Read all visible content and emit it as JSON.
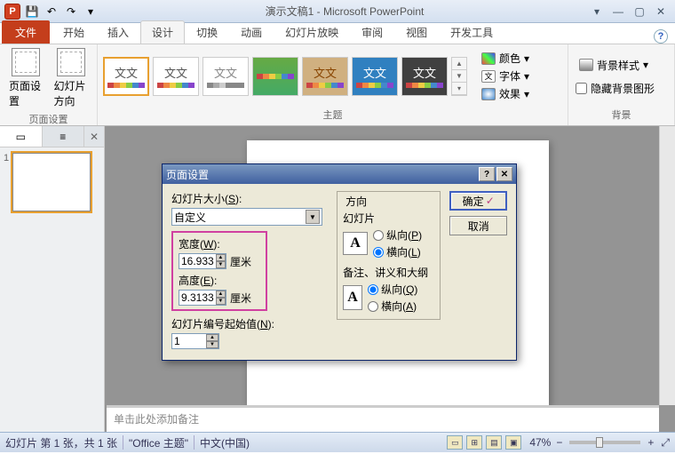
{
  "titlebar": {
    "app_title": "演示文稿1 - Microsoft PowerPoint",
    "logo": "P"
  },
  "win": {
    "min": "—",
    "max": "▢",
    "close": "✕",
    "rmin": "▾"
  },
  "tabs": {
    "file": "文件",
    "items": [
      "开始",
      "插入",
      "设计",
      "切换",
      "动画",
      "幻灯片放映",
      "审阅",
      "视图",
      "开发工具"
    ],
    "active_index": 2
  },
  "ribbon": {
    "page_setup": {
      "label": "页面设置",
      "btn1": "页面设置",
      "btn2": "幻灯片方向"
    },
    "themes": {
      "label": "主题",
      "sample": "文文",
      "colors": "颜色",
      "fonts": "字体",
      "effects": "效果"
    },
    "background": {
      "label": "背景",
      "styles": "背景样式",
      "hide_chk": "隐藏背景图形"
    }
  },
  "thumbs": {
    "num": "1"
  },
  "notes": {
    "placeholder": "单击此处添加备注"
  },
  "status": {
    "slide": "幻灯片 第 1 张，共 1 张",
    "theme": "\"Office 主题\"",
    "lang": "中文(中国)",
    "zoom": "47%",
    "minus": "−",
    "plus": "+",
    "fit": "⤢"
  },
  "dialog": {
    "title": "页面设置",
    "size_label": "幻灯片大小(S):",
    "size_value": "自定义",
    "width_label": "宽度(W):",
    "width_value": "16.933",
    "height_label": "高度(E):",
    "height_value": "9.3133",
    "unit": "厘米",
    "numbering_label": "幻灯片编号起始值(N):",
    "numbering_value": "1",
    "direction_label": "方向",
    "slides_label": "幻灯片",
    "notes_label": "备注、讲义和大纲",
    "portrait": "纵向(P)",
    "landscape": "横向(L)",
    "portrait2": "纵向(Q)",
    "landscape2": "横向(A)",
    "ok": "确定",
    "cancel": "取消",
    "help": "?",
    "close": "✕",
    "orient_icon": "A"
  }
}
